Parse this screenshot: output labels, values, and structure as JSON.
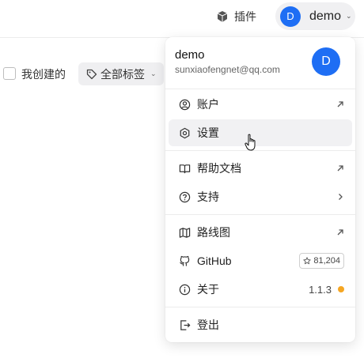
{
  "topbar": {
    "plugins_icon": "cube-icon",
    "plugins_label": "插件",
    "user_initial": "D",
    "user_name": "demo",
    "caret_icon": "chevron-down-icon"
  },
  "filters": {
    "my_created_label": "我创建的",
    "tags_label": "全部标签",
    "tags_icon": "tag-icon"
  },
  "menu": {
    "name": "demo",
    "email": "sunxiaofengnet@qq.com",
    "avatar_initial": "D",
    "items": [
      {
        "label": "账户",
        "icon": "user-circle-icon",
        "right": "arrow-up-right-icon"
      },
      {
        "label": "设置",
        "icon": "gear-icon",
        "right": ""
      },
      {
        "label": "帮助文档",
        "icon": "book-icon",
        "right": "arrow-up-right-icon"
      },
      {
        "label": "支持",
        "icon": "help-circle-icon",
        "right": "chevron-right-icon"
      },
      {
        "label": "路线图",
        "icon": "map-icon",
        "right": "arrow-up-right-icon"
      },
      {
        "label": "GitHub",
        "icon": "github-icon",
        "stars": "81,204"
      },
      {
        "label": "关于",
        "icon": "info-icon",
        "version": "1.1.3"
      },
      {
        "label": "登出",
        "icon": "logout-icon"
      }
    ]
  },
  "colors": {
    "accent": "#1e6ef4",
    "update_dot": "#f5a623",
    "hover_bg": "#f1f1f3"
  }
}
